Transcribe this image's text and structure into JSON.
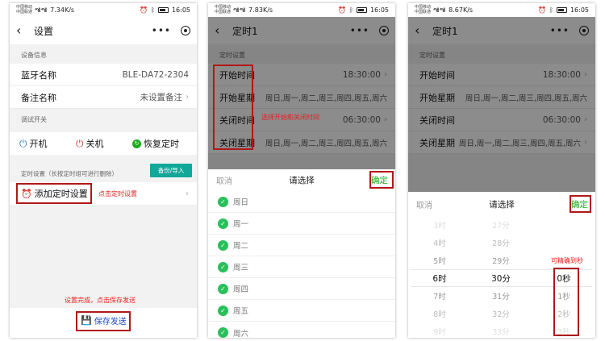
{
  "status": {
    "carrier1": "中国移动",
    "carrier2": "中国联通",
    "signal": "⁴⁶ıll ⁴⁶ıll",
    "time": "16:05",
    "speeds": [
      "7.34K/s",
      "7.83K/s",
      "8.67K/s"
    ]
  },
  "screen1": {
    "title": "设置",
    "device_section": "设备信息",
    "bt_label": "蓝牙名称",
    "bt_value": "BLE-DA72-2304",
    "note_label": "备注名称",
    "note_value": "未设置备注",
    "debug_section": "调试开关",
    "on_label": "开机",
    "off_label": "关机",
    "restore_label": "恢复定时",
    "timer_section": "定时设置（长按定时组可进行删除）",
    "backup_label": "备份/导入",
    "add_timer_label": "添加定时设置",
    "annot_click": "点击定时设置",
    "annot_save": "设置完成，点击保存发送",
    "save_label": "保存发送"
  },
  "screen2": {
    "title": "定时1",
    "section": "定时设置",
    "rows": [
      {
        "label": "开始时间",
        "value": "18:30:00"
      },
      {
        "label": "开始星期",
        "value": "周日,周一,周二,周三,周四,周五,周六"
      },
      {
        "label": "关闭时间",
        "value": "06:30:00"
      },
      {
        "label": "关闭星期",
        "value": "周日,周一,周二,周三,周四,周五,周六"
      }
    ],
    "annot": "选择开始和关闭时间",
    "sheet_cancel": "取消",
    "sheet_title": "请选择",
    "sheet_ok": "确定",
    "days": [
      "周日",
      "周一",
      "周二",
      "周三",
      "周四",
      "周五",
      "周六"
    ]
  },
  "screen3": {
    "title": "定时1",
    "section": "定时设置",
    "rows": [
      {
        "label": "开始时间",
        "value": "18:30:00"
      },
      {
        "label": "开始星期",
        "value": "周日,周一,周二,周三,周四,周五,周六"
      },
      {
        "label": "关闭时间",
        "value": "06:30:00"
      },
      {
        "label": "关闭星期",
        "value": "周日,周一,周二,周三,周四,周五,周六"
      }
    ],
    "sheet_cancel": "取消",
    "sheet_title": "请选择",
    "sheet_ok": "确定",
    "hours": [
      "3时",
      "4时",
      "5时",
      "6时",
      "7时",
      "8时",
      "9时"
    ],
    "minutes": [
      "27分",
      "28分",
      "29分",
      "30分",
      "31分",
      "32分",
      "33分"
    ],
    "seconds": [
      "0秒",
      "1秒",
      "2秒",
      "3秒"
    ],
    "annot": "可精确到秒"
  },
  "colors": {
    "accent_green": "#1aad19",
    "teal_button": "#10a89a",
    "annotation_red": "#e52020",
    "box_red": "#b01818"
  }
}
